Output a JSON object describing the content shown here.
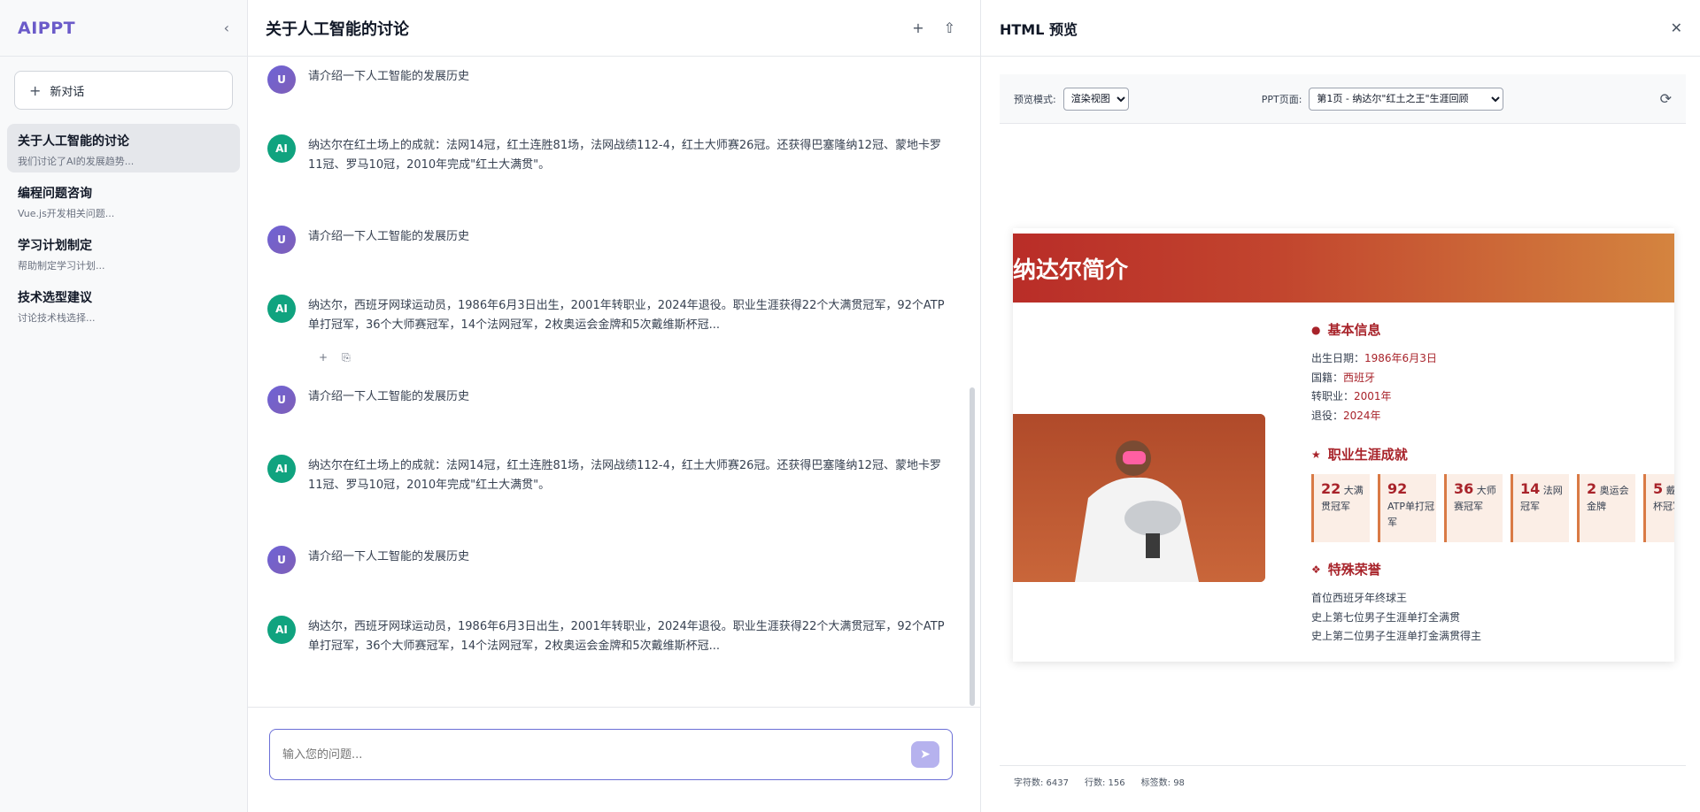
{
  "sidebar": {
    "logo": "AIPPT",
    "new_chat": "新对话",
    "conversations": [
      {
        "title": "关于人工智能的讨论",
        "subtitle": "我们讨论了AI的发展趋势..."
      },
      {
        "title": "编程问题咨询",
        "subtitle": "Vue.js开发相关问题..."
      },
      {
        "title": "学习计划制定",
        "subtitle": "帮助制定学习计划..."
      },
      {
        "title": "技术选型建议",
        "subtitle": "讨论技术栈选择..."
      }
    ]
  },
  "chat": {
    "title": "关于人工智能的讨论",
    "messages": [
      {
        "role": "U",
        "text": "请介绍一下人工智能的发展历史"
      },
      {
        "role": "AI",
        "text": "纳达尔在红土场上的成就：法网14冠，红土连胜81场，法网战绩112-4，红土大师赛26冠。还获得巴塞隆纳12冠、蒙地卡罗11冠、罗马10冠，2010年完成\"红土大满贯\"。"
      },
      {
        "role": "U",
        "text": "请介绍一下人工智能的发展历史"
      },
      {
        "role": "AI",
        "text": "纳达尔，西班牙网球运动员，1986年6月3日出生，2001年转职业，2024年退役。职业生涯获得22个大满贯冠军，92个ATP单打冠军，36个大师赛冠军，14个法网冠军，2枚奥运会金牌和5次戴维斯杯冠..."
      },
      {
        "role": "U",
        "text": "请介绍一下人工智能的发展历史"
      },
      {
        "role": "AI",
        "text": "纳达尔在红土场上的成就：法网14冠，红土连胜81场，法网战绩112-4，红土大师赛26冠。还获得巴塞隆纳12冠、蒙地卡罗11冠、罗马10冠，2010年完成\"红土大满贯\"。"
      },
      {
        "role": "U",
        "text": "请介绍一下人工智能的发展历史"
      },
      {
        "role": "AI",
        "text": "纳达尔，西班牙网球运动员，1986年6月3日出生，2001年转职业，2024年退役。职业生涯获得22个大满贯冠军，92个ATP单打冠军，36个大师赛冠军，14个法网冠军，2枚奥运会金牌和5次戴维斯杯冠..."
      }
    ],
    "input_placeholder": "输入您的问题..."
  },
  "preview": {
    "title": "HTML 预览",
    "mode_label": "预览模式:",
    "mode_value": "渲染视图",
    "page_label": "PPT页面:",
    "page_value": "第1页 - 纳达尔\"红土之王\"生涯回顾",
    "slide": {
      "heading": "纳达尔简介",
      "basic_title": "基本信息",
      "basic": [
        {
          "label": "出生日期：",
          "value": "1986年6月3日"
        },
        {
          "label": "国籍：",
          "value": "西班牙"
        },
        {
          "label": "转职业：",
          "value": "2001年"
        },
        {
          "label": "退役：",
          "value": "2024年"
        }
      ],
      "career_title": "职业生涯成就",
      "stats": [
        {
          "num": "22",
          "text": "大满贯冠军"
        },
        {
          "num": "92",
          "text": "ATP单打冠军"
        },
        {
          "num": "36",
          "text": "大师赛冠军"
        },
        {
          "num": "14",
          "text": "法网冠军"
        },
        {
          "num": "2",
          "text": "奥运会金牌"
        },
        {
          "num": "5",
          "text": "戴维斯杯冠军"
        }
      ],
      "honor_title": "特殊荣誉",
      "honors": [
        "首位西班牙年终球王",
        "史上第七位男子生涯单打全满贯",
        "史上第二位男子生涯单打金满贯得主"
      ]
    },
    "stats_footer": {
      "chars": "字符数: 6437",
      "lines": "行数: 156",
      "tags": "标签数: 98"
    }
  },
  "icons": {
    "collapse": "chevron-left-icon",
    "plus": "plus-icon",
    "share": "share-icon",
    "close": "close-icon",
    "refresh": "refresh-icon",
    "send": "send-icon",
    "copy": "clipboard-icon"
  },
  "colors": {
    "brand": "#6b5bc9",
    "ai_avatar": "#10a37f",
    "slide_accent": "#a8232a"
  }
}
